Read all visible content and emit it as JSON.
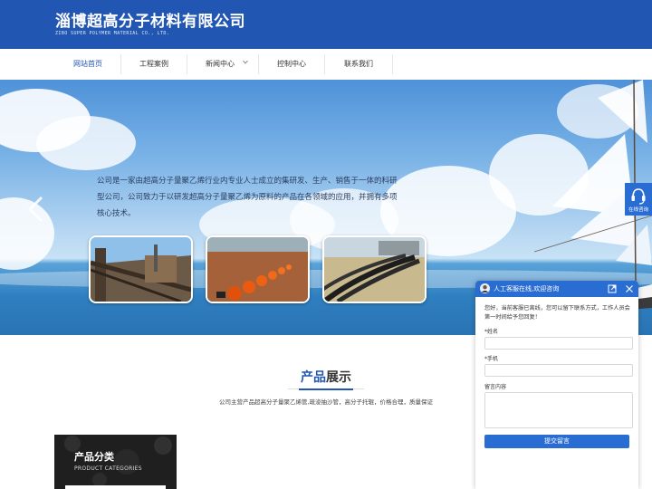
{
  "header": {
    "title": "淄博超高分子材料有限公司",
    "subtitle": "ZIBO  SUPER POLYMER MATERIAL CO., LTD."
  },
  "nav": {
    "items": [
      {
        "label": "网站首页",
        "active": true
      },
      {
        "label": "工程案例"
      },
      {
        "label": "新闻中心",
        "has_dropdown": true
      },
      {
        "label": "控制中心"
      },
      {
        "label": "联系我们"
      }
    ]
  },
  "banner": {
    "text": "公司是一家由超高分子量聚乙烯行业内专业人士成立的集研发、生产、销售于一体的科研型公司，公司致力于以研发超高分子量聚乙烯为原料的产品在各领域的应用，并拥有多项核心技术。",
    "thumbnails": [
      "industrial-pipeline-photo",
      "orange-floating-pipes-photo",
      "black-pipes-photo"
    ]
  },
  "products": {
    "title_blue": "产品",
    "title_dark": "展示",
    "description": "公司主营产品超高分子量聚乙烯管,疏浚抽沙管，高分子托辊，价格合理，质量保证"
  },
  "category": {
    "title": "产品分类",
    "subtitle": "PRODUCT CATEGORIES"
  },
  "online": {
    "label": "在线咨询",
    "icon": "headset-icon"
  },
  "chat": {
    "header": "人工客服在线,欢迎咨询",
    "message": "您好，当前客服已离线，您可以留下联系方式，工作人员会第一时间给予您回复！",
    "name_label": "*姓名",
    "phone_label": "*手机",
    "message_label": "留言内容",
    "submit_label": "提交留言"
  },
  "colors": {
    "brand_blue": "#2156b3",
    "chat_blue": "#2a6dd2"
  }
}
